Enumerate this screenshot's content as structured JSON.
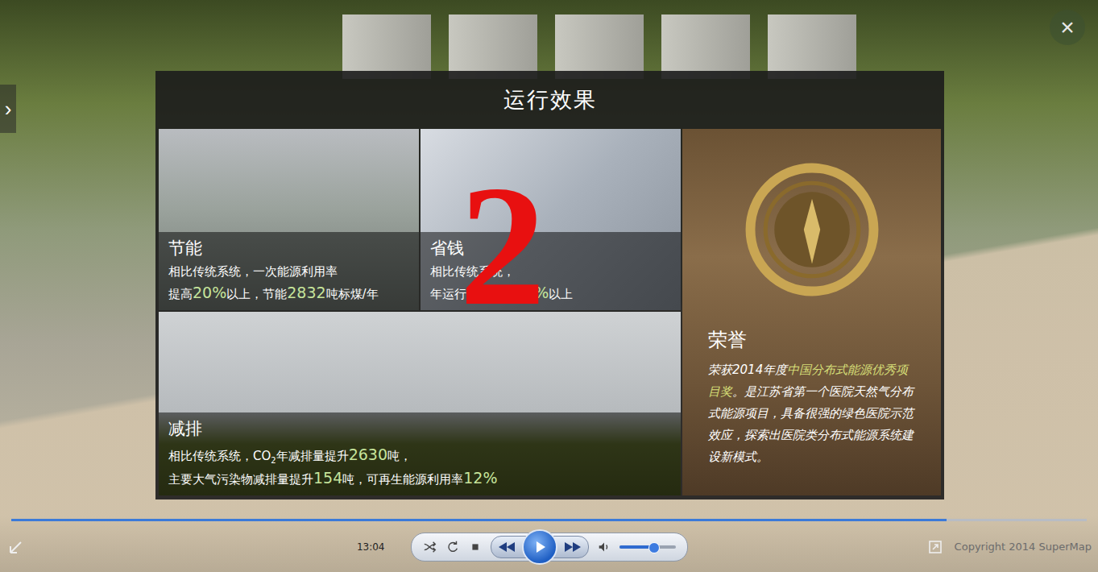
{
  "page": {
    "close": "×",
    "side_toggle": "›"
  },
  "dialog": {
    "title": "运行效果",
    "cards": [
      {
        "title": "节能",
        "lines": [
          [
            {
              "text": "相比传统系统，一次能源利用率",
              "highlight": false,
              "subscript": false
            }
          ],
          [
            {
              "text": "提高",
              "highlight": false,
              "subscript": false
            },
            {
              "text": "20%",
              "highlight": true,
              "subscript": false
            },
            {
              "text": "以上，节能",
              "highlight": false,
              "subscript": false
            },
            {
              "text": "2832",
              "highlight": true,
              "subscript": false
            },
            {
              "text": "吨标煤/年",
              "highlight": false,
              "subscript": false
            }
          ]
        ]
      },
      {
        "title": "省钱",
        "lines": [
          [
            {
              "text": "相比传统系统，",
              "highlight": false,
              "subscript": false
            }
          ],
          [
            {
              "text": "年运行费用节约",
              "highlight": false,
              "subscript": false
            },
            {
              "text": "20%",
              "highlight": true,
              "subscript": false
            },
            {
              "text": "以上",
              "highlight": false,
              "subscript": false
            }
          ]
        ]
      },
      {
        "title": "减排",
        "lines": [
          [
            {
              "text": "相比传统系统，CO",
              "highlight": false,
              "subscript": false
            },
            {
              "text": "2",
              "highlight": false,
              "subscript": true
            },
            {
              "text": "年减排量提升",
              "highlight": false,
              "subscript": false
            },
            {
              "text": "2630",
              "highlight": true,
              "subscript": false
            },
            {
              "text": "吨，",
              "highlight": false,
              "subscript": false
            }
          ],
          [
            {
              "text": "主要大气污染物减排量提升",
              "highlight": false,
              "subscript": false
            },
            {
              "text": "154",
              "highlight": true,
              "subscript": false
            },
            {
              "text": "吨，可再生能源利用率",
              "highlight": false,
              "subscript": false
            },
            {
              "text": "12%",
              "highlight": true,
              "subscript": false
            }
          ]
        ]
      }
    ],
    "honor": {
      "title": "荣誉",
      "segments": [
        {
          "text": "荣获2014年度",
          "highlight": false,
          "subscript": false
        },
        {
          "text": "中国分布式能源优秀项目奖",
          "highlight": true,
          "subscript": false
        },
        {
          "text": "。是江苏省第一个医院天然气分布式能源项目，具备很强的绿色医院示范效应，探索出医院类分布式能源系统建设新模式。",
          "highlight": false,
          "subscript": false
        }
      ]
    }
  },
  "overlay_label": "2",
  "player": {
    "time": "13:04",
    "progress": 0.87,
    "volume": 0.6,
    "playing": false
  },
  "copyright": "Copyright 2014 SuperMap"
}
